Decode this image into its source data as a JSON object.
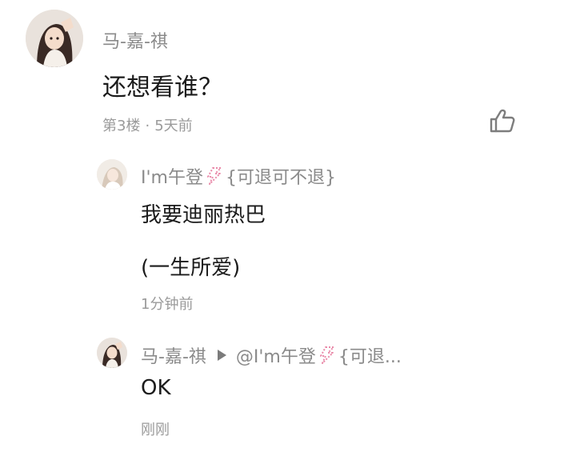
{
  "main_comment": {
    "author": "马-嘉-祺",
    "text": "还想看谁？",
    "floor": "第3楼",
    "separator": "·",
    "time": "5天前"
  },
  "replies": [
    {
      "author": "I'm午登",
      "author_suffix": "{可退可不退}",
      "text_line1": "我要迪丽热巴",
      "text_line2": "(一生所爱)",
      "time": "1分钟前"
    },
    {
      "author": "马-嘉-祺",
      "reply_to": "@I'm午登",
      "reply_to_suffix": "{可退...",
      "text": "OK",
      "time": "刚刚"
    }
  ],
  "colors": {
    "name": "#8a8a8a",
    "text": "#1b1b1b",
    "meta": "#9a9a9a",
    "badge": "#e98aa9"
  }
}
